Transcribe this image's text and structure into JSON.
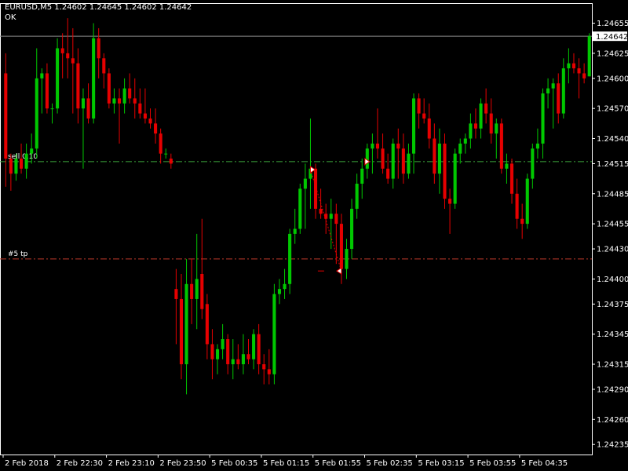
{
  "header": {
    "title": "EURUSD,M5  1.24602 1.24645 1.24602 1.24642",
    "status": "OK"
  },
  "chart_data": {
    "type": "candlestick",
    "symbol": "EURUSD",
    "timeframe": "M5",
    "ohlc_header": {
      "open": 1.24602,
      "high": 1.24645,
      "low": 1.24602,
      "close": 1.24642
    },
    "ylim": [
      1.24225,
      1.24675
    ],
    "y_ticks": [
      "1.24655",
      "1.24625",
      "1.24600",
      "1.24570",
      "1.24540",
      "1.24515",
      "1.24485",
      "1.24455",
      "1.24430",
      "1.24400",
      "1.24375",
      "1.24345",
      "1.24315",
      "1.24290",
      "1.24260",
      "1.24235"
    ],
    "x_ticks": [
      "2 Feb 2018",
      "2 Feb 22:30",
      "2 Feb 23:10",
      "2 Feb 23:50",
      "5 Feb 00:35",
      "5 Feb 01:15",
      "5 Feb 01:55",
      "5 Feb 02:35",
      "5 Feb 03:15",
      "5 Feb 03:55",
      "5 Feb 04:35"
    ],
    "bid_line": {
      "value": 1.24642,
      "label": "1.24642"
    },
    "order_lines": [
      {
        "name": "sell 0.10",
        "label": "sell 0.10",
        "value": 1.24517,
        "color": "#3ca83c",
        "style": "dash-dot"
      },
      {
        "name": "#5 tp",
        "label": "#5 tp",
        "value": 1.2442,
        "color": "#c0392b",
        "style": "dash-dot"
      }
    ],
    "trade": {
      "open_bar": 59,
      "open_price": 1.24509,
      "close_bar": 65,
      "close_price": 1.24408,
      "entry_marker_bar": 70,
      "entry_marker_price": 1.24517
    },
    "colors": {
      "bull": "#00c800",
      "bear": "#e60000",
      "grid": "#ffffff",
      "background": "#000000"
    },
    "grid": false,
    "candles": [
      {
        "o": 1.24605,
        "h": 1.24625,
        "l": 1.24492,
        "c": 1.2452
      },
      {
        "o": 1.2452,
        "h": 1.24525,
        "l": 1.24488,
        "c": 1.24505
      },
      {
        "o": 1.24505,
        "h": 1.24525,
        "l": 1.24498,
        "c": 1.2452
      },
      {
        "o": 1.2452,
        "h": 1.24535,
        "l": 1.24505,
        "c": 1.2451
      },
      {
        "o": 1.2451,
        "h": 1.24535,
        "l": 1.245,
        "c": 1.24525
      },
      {
        "o": 1.24525,
        "h": 1.24545,
        "l": 1.24515,
        "c": 1.2453
      },
      {
        "o": 1.2453,
        "h": 1.2463,
        "l": 1.2452,
        "c": 1.246
      },
      {
        "o": 1.246,
        "h": 1.2461,
        "l": 1.24565,
        "c": 1.24605
      },
      {
        "o": 1.24605,
        "h": 1.24615,
        "l": 1.24565,
        "c": 1.2457
      },
      {
        "o": 1.2457,
        "h": 1.24575,
        "l": 1.24555,
        "c": 1.2457
      },
      {
        "o": 1.2457,
        "h": 1.2464,
        "l": 1.24565,
        "c": 1.2463
      },
      {
        "o": 1.2463,
        "h": 1.24645,
        "l": 1.246,
        "c": 1.24625
      },
      {
        "o": 1.24625,
        "h": 1.2466,
        "l": 1.246,
        "c": 1.2462
      },
      {
        "o": 1.2462,
        "h": 1.2465,
        "l": 1.24565,
        "c": 1.24615
      },
      {
        "o": 1.24615,
        "h": 1.2463,
        "l": 1.24555,
        "c": 1.2457
      },
      {
        "o": 1.2457,
        "h": 1.2459,
        "l": 1.2451,
        "c": 1.2458
      },
      {
        "o": 1.2458,
        "h": 1.24595,
        "l": 1.24555,
        "c": 1.2456
      },
      {
        "o": 1.2456,
        "h": 1.24655,
        "l": 1.24555,
        "c": 1.2464
      },
      {
        "o": 1.2464,
        "h": 1.2465,
        "l": 1.246,
        "c": 1.2462
      },
      {
        "o": 1.2462,
        "h": 1.24625,
        "l": 1.2459,
        "c": 1.24605
      },
      {
        "o": 1.24605,
        "h": 1.2461,
        "l": 1.2457,
        "c": 1.24575
      },
      {
        "o": 1.24575,
        "h": 1.2459,
        "l": 1.24565,
        "c": 1.2458
      },
      {
        "o": 1.2458,
        "h": 1.2459,
        "l": 1.24535,
        "c": 1.24575
      },
      {
        "o": 1.24575,
        "h": 1.246,
        "l": 1.24565,
        "c": 1.2459
      },
      {
        "o": 1.2459,
        "h": 1.24605,
        "l": 1.24575,
        "c": 1.2458
      },
      {
        "o": 1.2458,
        "h": 1.246,
        "l": 1.2456,
        "c": 1.24575
      },
      {
        "o": 1.24575,
        "h": 1.2459,
        "l": 1.2456,
        "c": 1.24565
      },
      {
        "o": 1.24565,
        "h": 1.2459,
        "l": 1.24555,
        "c": 1.2456
      },
      {
        "o": 1.2456,
        "h": 1.2457,
        "l": 1.2455,
        "c": 1.24555
      },
      {
        "o": 1.24555,
        "h": 1.2457,
        "l": 1.24535,
        "c": 1.24545
      },
      {
        "o": 1.24545,
        "h": 1.2455,
        "l": 1.24515,
        "c": 1.24525
      },
      {
        "o": 1.24525,
        "h": 1.2453,
        "l": 1.2452,
        "c": 1.24525
      },
      {
        "o": 1.2452,
        "h": 1.24525,
        "l": 1.2451,
        "c": 1.24515
      },
      {
        "o": 1.2439,
        "h": 1.2441,
        "l": 1.24335,
        "c": 1.2438
      },
      {
        "o": 1.2438,
        "h": 1.24405,
        "l": 1.243,
        "c": 1.24315
      },
      {
        "o": 1.24315,
        "h": 1.2442,
        "l": 1.24285,
        "c": 1.24395
      },
      {
        "o": 1.24395,
        "h": 1.2442,
        "l": 1.24355,
        "c": 1.2438
      },
      {
        "o": 1.2438,
        "h": 1.24445,
        "l": 1.2435,
        "c": 1.244
      },
      {
        "o": 1.24405,
        "h": 1.2446,
        "l": 1.2436,
        "c": 1.2437
      },
      {
        "o": 1.24375,
        "h": 1.24385,
        "l": 1.2432,
        "c": 1.24335
      },
      {
        "o": 1.24335,
        "h": 1.2435,
        "l": 1.243,
        "c": 1.2432
      },
      {
        "o": 1.2432,
        "h": 1.24335,
        "l": 1.24305,
        "c": 1.2433
      },
      {
        "o": 1.2433,
        "h": 1.24355,
        "l": 1.2432,
        "c": 1.2434
      },
      {
        "o": 1.2434,
        "h": 1.24345,
        "l": 1.24305,
        "c": 1.24315
      },
      {
        "o": 1.24315,
        "h": 1.2434,
        "l": 1.243,
        "c": 1.2432
      },
      {
        "o": 1.2432,
        "h": 1.24335,
        "l": 1.2431,
        "c": 1.24315
      },
      {
        "o": 1.24315,
        "h": 1.24345,
        "l": 1.24305,
        "c": 1.24325
      },
      {
        "o": 1.24325,
        "h": 1.2434,
        "l": 1.24315,
        "c": 1.2432
      },
      {
        "o": 1.2432,
        "h": 1.2435,
        "l": 1.2431,
        "c": 1.24345
      },
      {
        "o": 1.24345,
        "h": 1.24355,
        "l": 1.24305,
        "c": 1.24315
      },
      {
        "o": 1.24315,
        "h": 1.24325,
        "l": 1.24295,
        "c": 1.2431
      },
      {
        "o": 1.2431,
        "h": 1.2433,
        "l": 1.24295,
        "c": 1.24305
      },
      {
        "o": 1.24305,
        "h": 1.24395,
        "l": 1.24295,
        "c": 1.24385
      },
      {
        "o": 1.24385,
        "h": 1.244,
        "l": 1.24375,
        "c": 1.2439
      },
      {
        "o": 1.2439,
        "h": 1.2441,
        "l": 1.2438,
        "c": 1.24395
      },
      {
        "o": 1.24395,
        "h": 1.2445,
        "l": 1.24385,
        "c": 1.24445
      },
      {
        "o": 1.24445,
        "h": 1.2447,
        "l": 1.24435,
        "c": 1.2445
      },
      {
        "o": 1.2445,
        "h": 1.24495,
        "l": 1.24445,
        "c": 1.2449
      },
      {
        "o": 1.2449,
        "h": 1.24515,
        "l": 1.2445,
        "c": 1.245
      },
      {
        "o": 1.245,
        "h": 1.2456,
        "l": 1.2447,
        "c": 1.2451
      },
      {
        "o": 1.2451,
        "h": 1.24515,
        "l": 1.2446,
        "c": 1.2447
      },
      {
        "o": 1.2447,
        "h": 1.2449,
        "l": 1.2446,
        "c": 1.24465
      },
      {
        "o": 1.24465,
        "h": 1.24475,
        "l": 1.24445,
        "c": 1.2446
      },
      {
        "o": 1.2446,
        "h": 1.2448,
        "l": 1.2443,
        "c": 1.24465
      },
      {
        "o": 1.24465,
        "h": 1.24475,
        "l": 1.24415,
        "c": 1.24455
      },
      {
        "o": 1.24455,
        "h": 1.24465,
        "l": 1.24395,
        "c": 1.2441
      },
      {
        "o": 1.2441,
        "h": 1.2444,
        "l": 1.244,
        "c": 1.2443
      },
      {
        "o": 1.2443,
        "h": 1.2448,
        "l": 1.2442,
        "c": 1.2447
      },
      {
        "o": 1.2447,
        "h": 1.24505,
        "l": 1.2446,
        "c": 1.24495
      },
      {
        "o": 1.24495,
        "h": 1.2452,
        "l": 1.2448,
        "c": 1.2451
      },
      {
        "o": 1.2451,
        "h": 1.24535,
        "l": 1.245,
        "c": 1.2453
      },
      {
        "o": 1.2453,
        "h": 1.24545,
        "l": 1.24505,
        "c": 1.24535
      },
      {
        "o": 1.24535,
        "h": 1.2457,
        "l": 1.2452,
        "c": 1.2453
      },
      {
        "o": 1.2453,
        "h": 1.24545,
        "l": 1.24505,
        "c": 1.2451
      },
      {
        "o": 1.2451,
        "h": 1.24525,
        "l": 1.24495,
        "c": 1.245
      },
      {
        "o": 1.245,
        "h": 1.2454,
        "l": 1.2449,
        "c": 1.24535
      },
      {
        "o": 1.24535,
        "h": 1.2455,
        "l": 1.245,
        "c": 1.2453
      },
      {
        "o": 1.2453,
        "h": 1.24545,
        "l": 1.24495,
        "c": 1.24505
      },
      {
        "o": 1.24505,
        "h": 1.24535,
        "l": 1.245,
        "c": 1.24525
      },
      {
        "o": 1.24525,
        "h": 1.24585,
        "l": 1.24505,
        "c": 1.2458
      },
      {
        "o": 1.2458,
        "h": 1.24585,
        "l": 1.2455,
        "c": 1.24565
      },
      {
        "o": 1.24565,
        "h": 1.2458,
        "l": 1.24555,
        "c": 1.2456
      },
      {
        "o": 1.2456,
        "h": 1.24575,
        "l": 1.2453,
        "c": 1.2454
      },
      {
        "o": 1.2454,
        "h": 1.24555,
        "l": 1.24495,
        "c": 1.24505
      },
      {
        "o": 1.24505,
        "h": 1.2455,
        "l": 1.24485,
        "c": 1.24535
      },
      {
        "o": 1.24535,
        "h": 1.24545,
        "l": 1.2447,
        "c": 1.2448
      },
      {
        "o": 1.2448,
        "h": 1.2449,
        "l": 1.24445,
        "c": 1.24475
      },
      {
        "o": 1.24475,
        "h": 1.2453,
        "l": 1.2447,
        "c": 1.24525
      },
      {
        "o": 1.24525,
        "h": 1.2454,
        "l": 1.24515,
        "c": 1.24535
      },
      {
        "o": 1.24535,
        "h": 1.24545,
        "l": 1.24525,
        "c": 1.2454
      },
      {
        "o": 1.2454,
        "h": 1.24565,
        "l": 1.2453,
        "c": 1.24555
      },
      {
        "o": 1.24555,
        "h": 1.2457,
        "l": 1.2454,
        "c": 1.2455
      },
      {
        "o": 1.2455,
        "h": 1.2458,
        "l": 1.2454,
        "c": 1.24575
      },
      {
        "o": 1.24575,
        "h": 1.2459,
        "l": 1.24555,
        "c": 1.24565
      },
      {
        "o": 1.24565,
        "h": 1.2458,
        "l": 1.24535,
        "c": 1.24545
      },
      {
        "o": 1.24545,
        "h": 1.2456,
        "l": 1.2452,
        "c": 1.24555
      },
      {
        "o": 1.24555,
        "h": 1.2456,
        "l": 1.24505,
        "c": 1.2451
      },
      {
        "o": 1.2451,
        "h": 1.24525,
        "l": 1.24495,
        "c": 1.24515
      },
      {
        "o": 1.24515,
        "h": 1.2452,
        "l": 1.24475,
        "c": 1.24485
      },
      {
        "o": 1.24485,
        "h": 1.245,
        "l": 1.2445,
        "c": 1.2446
      },
      {
        "o": 1.2446,
        "h": 1.24475,
        "l": 1.2444,
        "c": 1.24455
      },
      {
        "o": 1.24455,
        "h": 1.24505,
        "l": 1.2445,
        "c": 1.245
      },
      {
        "o": 1.245,
        "h": 1.24535,
        "l": 1.2449,
        "c": 1.2453
      },
      {
        "o": 1.2453,
        "h": 1.2455,
        "l": 1.2452,
        "c": 1.24535
      },
      {
        "o": 1.24535,
        "h": 1.2459,
        "l": 1.2452,
        "c": 1.24585
      },
      {
        "o": 1.24585,
        "h": 1.246,
        "l": 1.2457,
        "c": 1.2459
      },
      {
        "o": 1.2459,
        "h": 1.246,
        "l": 1.2455,
        "c": 1.24595
      },
      {
        "o": 1.24595,
        "h": 1.24605,
        "l": 1.24555,
        "c": 1.24565
      },
      {
        "o": 1.24565,
        "h": 1.2462,
        "l": 1.2456,
        "c": 1.2461
      },
      {
        "o": 1.2461,
        "h": 1.2463,
        "l": 1.24595,
        "c": 1.24615
      },
      {
        "o": 1.24615,
        "h": 1.24625,
        "l": 1.24605,
        "c": 1.2461
      },
      {
        "o": 1.2461,
        "h": 1.2462,
        "l": 1.2458,
        "c": 1.24605
      },
      {
        "o": 1.24605,
        "h": 1.24615,
        "l": 1.24595,
        "c": 1.246
      },
      {
        "o": 1.24602,
        "h": 1.24645,
        "l": 1.24602,
        "c": 1.24642
      }
    ]
  }
}
